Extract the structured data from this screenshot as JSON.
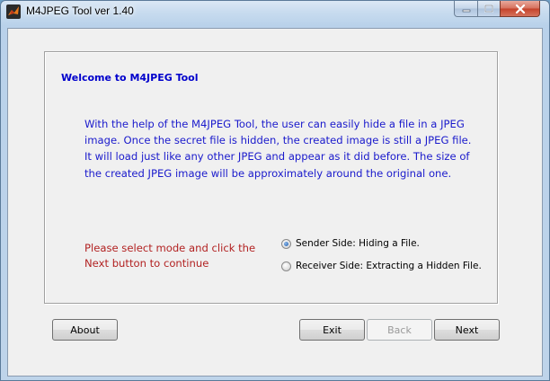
{
  "window": {
    "title": "M4JPEG Tool ver 1.40",
    "controls": {
      "minimize_icon": "minimize-icon",
      "maximize_icon": "maximize-icon",
      "close_icon": "close-icon"
    }
  },
  "panel": {
    "title": "Welcome to M4JPEG Tool",
    "description": "With the help of the M4JPEG Tool, the user can easily hide a file in a JPEG image. Once the secret file is hidden, the created image is still a JPEG file. It will load just like any other JPEG and appear as it did before. The size of the created JPEG image will be approximately around the original one.",
    "instruction": "Please select mode and click the Next button to continue",
    "modes": [
      {
        "label": "Sender Side: Hiding a File.",
        "selected": true
      },
      {
        "label": "Receiver Side: Extracting a Hidden File.",
        "selected": false
      }
    ]
  },
  "buttons": {
    "about": "About",
    "exit": "Exit",
    "back": "Back",
    "next": "Next",
    "back_enabled": false
  },
  "colors": {
    "panel_title": "#0000cc",
    "description": "#1a1acc",
    "instruction": "#b22222"
  }
}
